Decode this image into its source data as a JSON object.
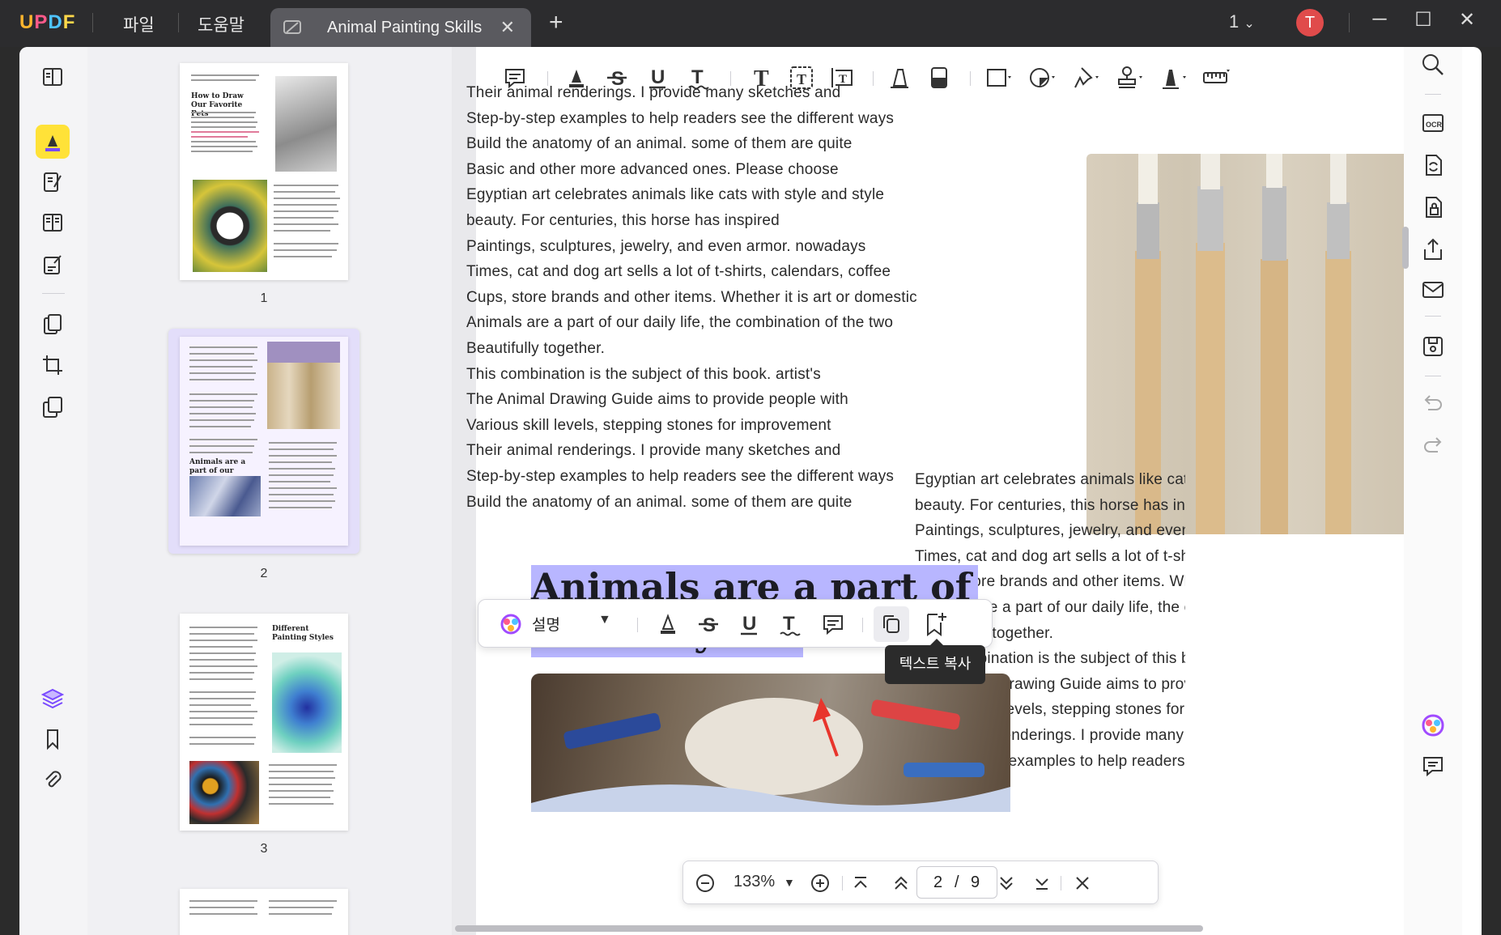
{
  "app": {
    "logo": "UPDF",
    "menu": [
      "파일",
      "도움말"
    ],
    "tab_title": "Animal Painting Skills",
    "page_indicator": "1",
    "user_initial": "T"
  },
  "thumbnails": {
    "pages": [
      {
        "number": "1",
        "heading": "How to Draw Our Favorite Pets"
      },
      {
        "number": "2",
        "heading": "Animals are a part of our daily life"
      },
      {
        "number": "3",
        "heading": "Different Painting Styles"
      }
    ]
  },
  "document": {
    "left_column": [
      "Their animal renderings. I provide many sketches and",
      "Step-by-step examples to help readers see the different ways",
      "Build the anatomy of an animal. some of them are quite",
      "Basic and other more advanced ones. Please choose",
      "Egyptian art celebrates animals like cats with style and style",
      "beauty. For centuries, this horse has inspired",
      "Paintings, sculptures, jewelry, and even armor. nowadays",
      "Times, cat and dog art sells a lot of t-shirts, calendars, coffee",
      "Cups, store brands and other items. Whether it is art or domestic",
      "Animals are a part of our daily life, the combination of the two",
      "Beautifully together.",
      "This combination is the subject of this book. artist's",
      "The Animal Drawing Guide aims to provide people with",
      "Various skill levels, stepping stones for improvement",
      "Their animal renderings. I provide many sketches and",
      "Step-by-step examples to help readers see the different ways",
      "Build the anatomy of an animal. some of them are quite"
    ],
    "right_column": [
      "Egyptian art celebrates animals like cats with",
      "beauty. For centuries, this horse has inspired",
      "Paintings, sculptures, jewelry, and even armo",
      "Times, cat and dog art sells a lot of t-shirts, c",
      "Cups, store brands and other items. Whether",
      "Animals are a part of our daily life, the comb",
      "Beautifully together.",
      "This combination is the subject of this book.",
      "The Animal Drawing Guide aims to provide pe",
      "Various skill levels, stepping stones for impro",
      "renderings. I provide many sket",
      "Step-by-step examples to help readers see th"
    ],
    "heading_line1": "Animals are a part of",
    "heading_line2": "our daily life"
  },
  "floatbar": {
    "label": "설명",
    "tooltip": "텍스트 복사"
  },
  "navbar": {
    "zoom": "133%",
    "current_page": "2",
    "separator": "/",
    "total_pages": "9"
  },
  "colors": {
    "highlight": "#b8b6ff",
    "active_tool": "#ffe238",
    "accent": "#7a4bff",
    "avatar": "#e04b4b",
    "arrow": "#e8352c"
  }
}
